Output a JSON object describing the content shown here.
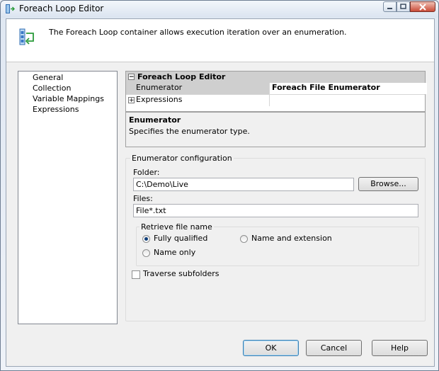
{
  "window": {
    "title": "Foreach Loop Editor"
  },
  "header": {
    "description": "The Foreach Loop container allows execution iteration over an enumeration."
  },
  "nav": {
    "items": [
      "General",
      "Collection",
      "Variable Mappings",
      "Expressions"
    ],
    "selected": "Collection"
  },
  "property_grid": {
    "category": "Foreach Loop Editor",
    "rows": [
      {
        "name": "Enumerator",
        "value": "Foreach File Enumerator"
      },
      {
        "name": "Expressions",
        "value": ""
      }
    ]
  },
  "description_panel": {
    "title": "Enumerator",
    "text": "Specifies the enumerator type."
  },
  "enumerator_config": {
    "legend": "Enumerator configuration",
    "folder_label": "Folder:",
    "folder_value": "C:\\Demo\\Live",
    "browse_label": "Browse...",
    "files_label": "Files:",
    "files_value": "File*.txt",
    "retrieve_legend": "Retrieve file name",
    "radio_fully_qualified": "Fully qualified",
    "radio_name_extension": "Name and extension",
    "radio_name_only": "Name only",
    "selected_option": "Fully qualified",
    "traverse_label": "Traverse subfolders",
    "traverse_checked": false
  },
  "footer": {
    "ok_label": "OK",
    "cancel_label": "Cancel",
    "help_label": "Help"
  }
}
